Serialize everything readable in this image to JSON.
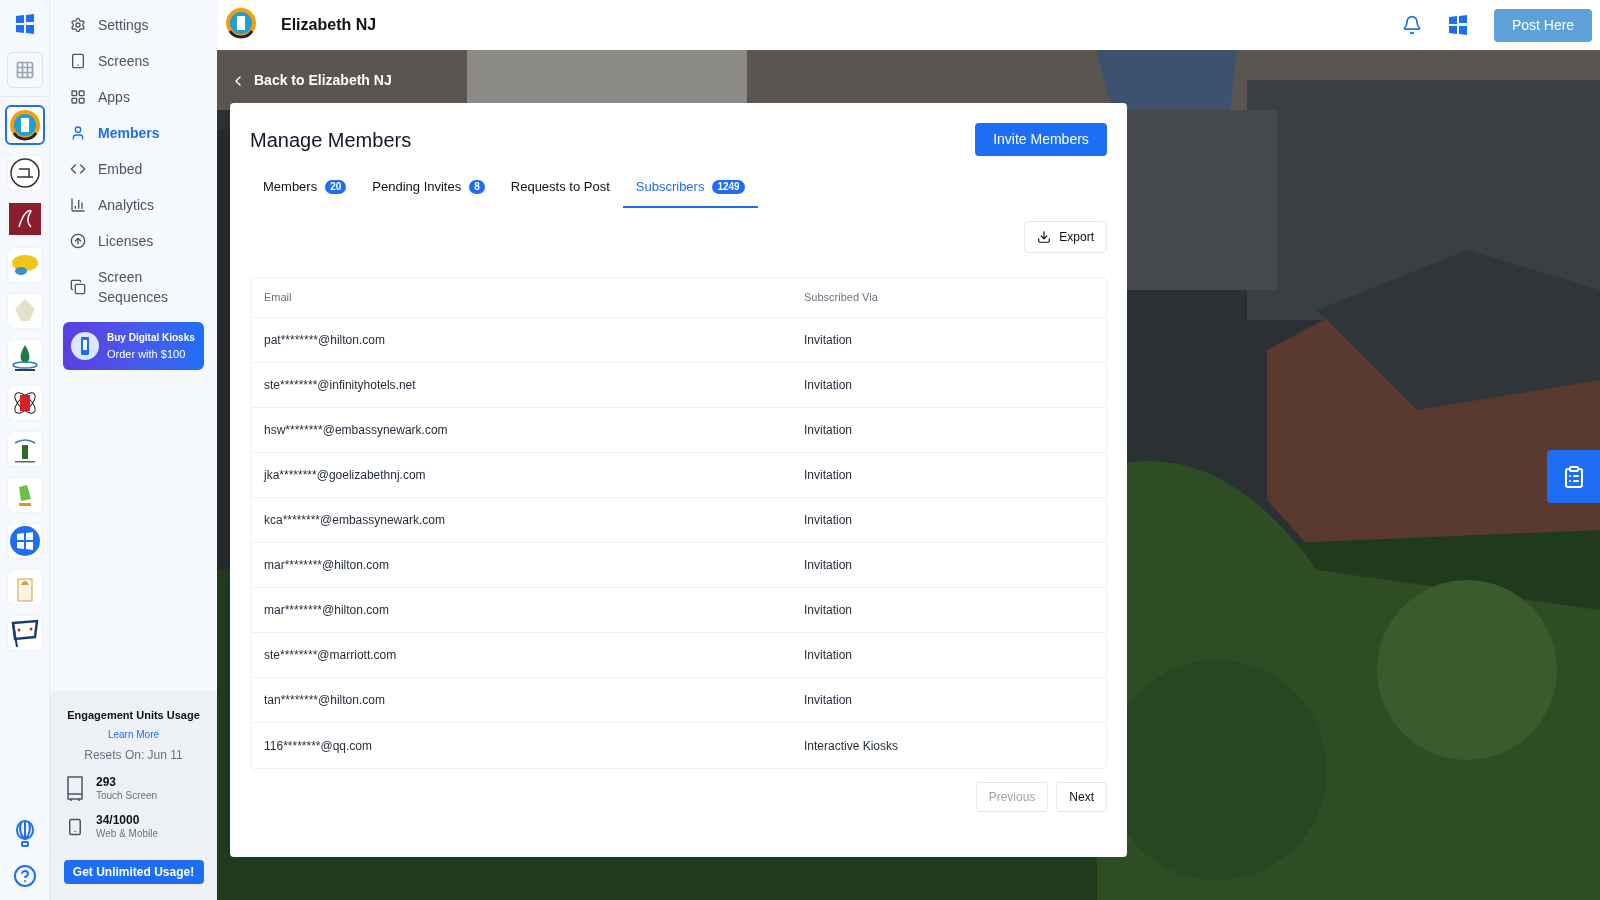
{
  "rail": {
    "workspaces": [
      {
        "kind": "circle-e",
        "selected": true
      },
      {
        "kind": "sketch",
        "selected": false
      },
      {
        "kind": "script",
        "selected": false
      },
      {
        "kind": "yellow",
        "selected": false
      },
      {
        "kind": "leaf",
        "selected": false
      },
      {
        "kind": "drop",
        "selected": false
      },
      {
        "kind": "atom",
        "selected": false
      },
      {
        "kind": "tower",
        "selected": false
      },
      {
        "kind": "plant",
        "selected": false
      },
      {
        "kind": "brand",
        "selected": false
      },
      {
        "kind": "dome",
        "selected": false
      },
      {
        "kind": "flag",
        "selected": false
      }
    ]
  },
  "sidebar": {
    "items": [
      {
        "kind": "settings",
        "label": "Settings",
        "selected": false
      },
      {
        "kind": "screen",
        "label": "Screens",
        "selected": false
      },
      {
        "kind": "apps",
        "label": "Apps",
        "selected": false
      },
      {
        "kind": "user",
        "label": "Members",
        "selected": true
      },
      {
        "kind": "code",
        "label": "Embed",
        "selected": false
      },
      {
        "kind": "chart",
        "label": "Analytics",
        "selected": false
      },
      {
        "kind": "upload",
        "label": "Licenses",
        "selected": false
      },
      {
        "kind": "sequence",
        "label": "Screen Sequences",
        "selected": false
      }
    ],
    "promo": {
      "title": "Buy Digital Kiosks",
      "subtitle": "Order with $100"
    },
    "usage": {
      "title": "Engagement Units Usage",
      "link": "Learn More",
      "resets": "Resets On: Jun 11",
      "meters": [
        {
          "kind": "kiosk",
          "value": "293",
          "label": "Touch Screen"
        },
        {
          "kind": "phone",
          "value": "34/1000",
          "label": "Web & Mobile"
        }
      ],
      "button": "Get Unlimited Usage!"
    }
  },
  "header": {
    "title": "Elizabeth NJ",
    "post_button": "Post Here"
  },
  "back_link": "Back to Elizabeth NJ",
  "card": {
    "title": "Manage Members",
    "invite_button": "Invite Members",
    "tabs": [
      {
        "label": "Members",
        "count": "20",
        "selected": false
      },
      {
        "label": "Pending Invites",
        "count": "8",
        "selected": false
      },
      {
        "label": "Requests to Post",
        "selected": false
      },
      {
        "label": "Subscribers",
        "count": "1249",
        "selected": true
      }
    ],
    "export_button": "Export",
    "table": {
      "columns": [
        "Email",
        "Subscribed Via"
      ],
      "rows": [
        [
          "pat********@hilton.com",
          "Invitation"
        ],
        [
          "ste********@infinityhotels.net",
          "Invitation"
        ],
        [
          "hsw********@embassynewark.com",
          "Invitation"
        ],
        [
          "jka********@goelizabethnj.com",
          "Invitation"
        ],
        [
          "kca********@embassynewark.com",
          "Invitation"
        ],
        [
          "mar********@hilton.com",
          "Invitation"
        ],
        [
          "mar********@hilton.com",
          "Invitation"
        ],
        [
          "ste********@marriott.com",
          "Invitation"
        ],
        [
          "tan********@hilton.com",
          "Invitation"
        ],
        [
          "116********@qq.com",
          "Interactive Kiosks"
        ]
      ]
    },
    "pagination": [
      {
        "label": "Previous",
        "disabled": true
      },
      {
        "label": "Next",
        "disabled": false
      }
    ]
  }
}
